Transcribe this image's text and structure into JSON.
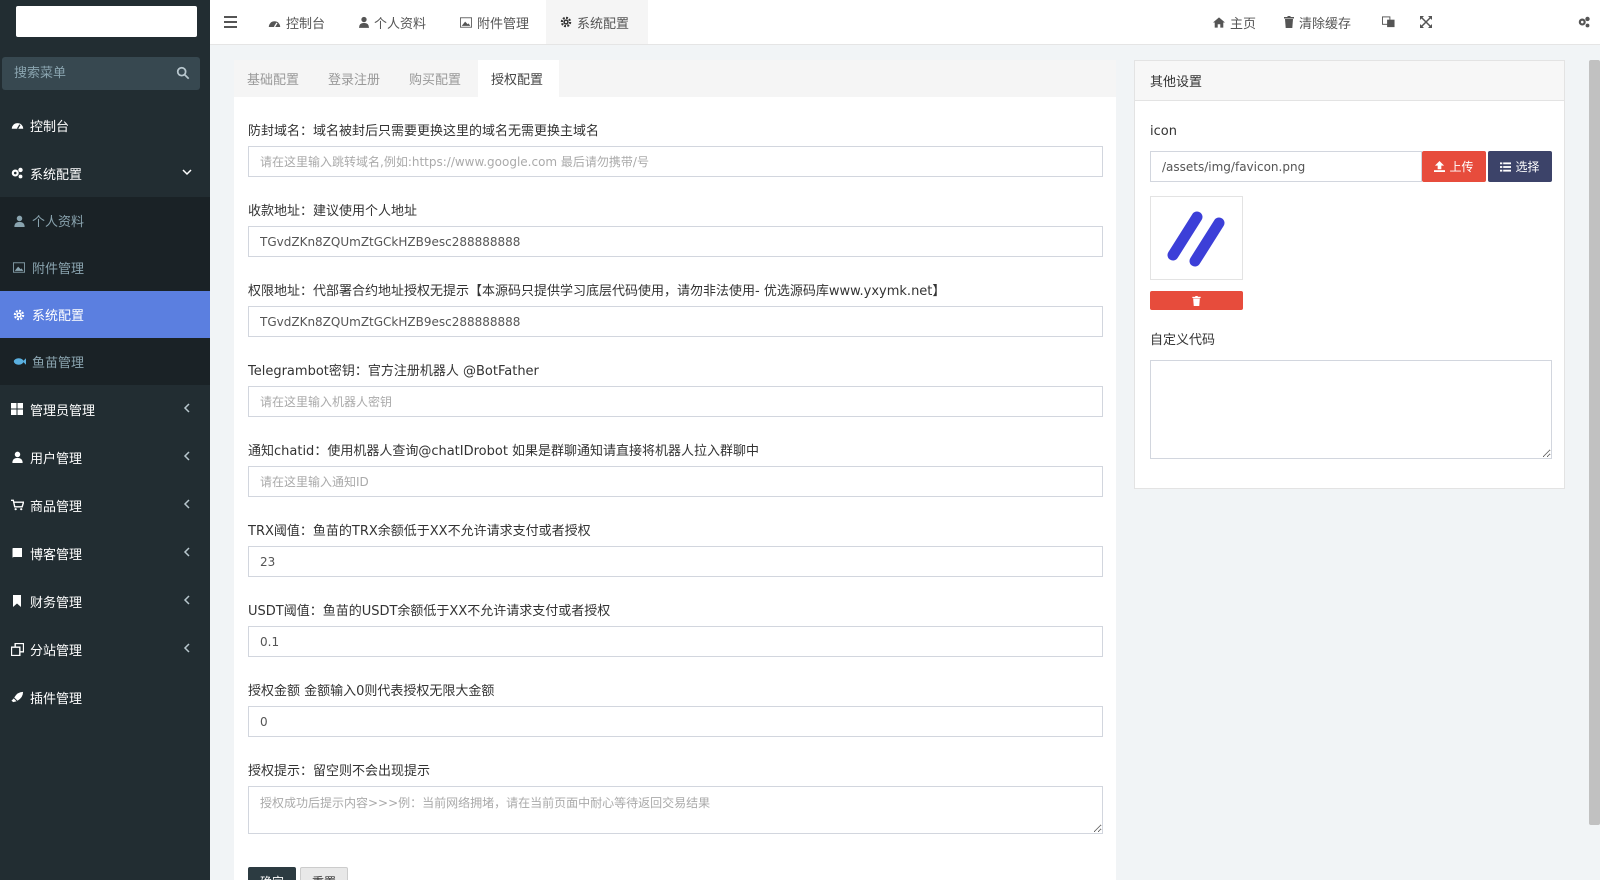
{
  "sidebar": {
    "search_placeholder": "搜索菜单",
    "items": [
      {
        "label": "控制台",
        "icon": "dashboard-icon"
      },
      {
        "label": "系统配置",
        "icon": "cogs-icon",
        "expanded": true
      },
      {
        "label": "管理员管理",
        "icon": "windows-icon"
      },
      {
        "label": "用户管理",
        "icon": "user-icon"
      },
      {
        "label": "商品管理",
        "icon": "cart-icon"
      },
      {
        "label": "博客管理",
        "icon": "book-icon"
      },
      {
        "label": "财务管理",
        "icon": "bookmark-icon"
      },
      {
        "label": "分站管理",
        "icon": "clone-icon"
      },
      {
        "label": "插件管理",
        "icon": "rocket-icon"
      }
    ],
    "subitems": [
      {
        "label": "个人资料",
        "icon": "user-icon"
      },
      {
        "label": "附件管理",
        "icon": "image-icon"
      },
      {
        "label": "系统配置",
        "icon": "gear-icon",
        "active": true
      },
      {
        "label": "鱼苗管理",
        "icon": "fish-icon"
      }
    ]
  },
  "topbar": {
    "tabs": [
      {
        "label": "控制台",
        "icon": "dashboard-icon"
      },
      {
        "label": "个人资料",
        "icon": "user-icon"
      },
      {
        "label": "附件管理",
        "icon": "image-icon"
      },
      {
        "label": "系统配置",
        "icon": "gear-icon",
        "active": true
      }
    ],
    "home": "主页",
    "clear_cache": "清除缓存"
  },
  "config_tabs": [
    "基础配置",
    "登录注册",
    "购买配置",
    "授权配置"
  ],
  "fields": [
    {
      "label": "防封域名：域名被封后只需要更换这里的域名无需更换主域名",
      "value": "",
      "placeholder": "请在这里输入跳转域名,例如:https://www.google.com 最后请勿携带/号"
    },
    {
      "label": "收款地址：建议使用个人地址",
      "value": "TGvdZKn8ZQUmZtGCkHZB9esc288888888",
      "placeholder": ""
    },
    {
      "label": "权限地址：代部署合约地址授权无提示【本源码只提供学习底层代码使用，请勿非法使用- 优选源码库www.yxymk.net】",
      "value": "TGvdZKn8ZQUmZtGCkHZB9esc288888888",
      "placeholder": ""
    },
    {
      "label": "Telegrambot密钥：官方注册机器人 @BotFather",
      "value": "",
      "placeholder": "请在这里输入机器人密钥"
    },
    {
      "label": "通知chatid：使用机器人查询@chatIDrobot 如果是群聊通知请直接将机器人拉入群聊中",
      "value": "",
      "placeholder": "请在这里输入通知ID"
    },
    {
      "label": "TRX阈值：鱼苗的TRX余额低于XX不允许请求支付或者授权",
      "value": "23",
      "placeholder": ""
    },
    {
      "label": "USDT阈值：鱼苗的USDT余额低于XX不允许请求支付或者授权",
      "value": "0.1",
      "placeholder": ""
    },
    {
      "label": "授权金额 金额输入0则代表授权无限大金额",
      "value": "0",
      "placeholder": ""
    },
    {
      "label": "授权提示：留空则不会出现提示",
      "value": "",
      "placeholder": "授权成功后提示内容>>>例：当前网络拥堵，请在当前页面中耐心等待返回交易结果"
    }
  ],
  "buttons": {
    "ok": "确定",
    "reset": "重置"
  },
  "other_settings": {
    "title": "其他设置",
    "icon_label": "icon",
    "icon_value": "/assets/img/favicon.png",
    "upload": "上传",
    "select": "选择",
    "custom_code_label": "自定义代码"
  },
  "colors": {
    "sidebar_bg": "#222d32",
    "active_item": "#5b7fe0",
    "danger": "#e74c3c",
    "select_btn": "#3c4369"
  }
}
